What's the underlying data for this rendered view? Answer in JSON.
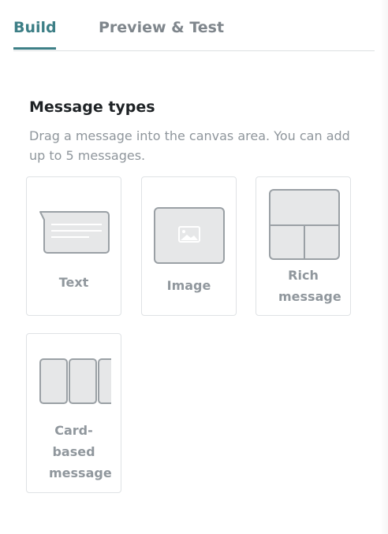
{
  "tabs": [
    {
      "label": "Build",
      "active": true
    },
    {
      "label": "Preview & Test",
      "active": false
    }
  ],
  "section": {
    "title": "Message types",
    "description": "Drag a message into the canvas area. You can add up to 5 messages."
  },
  "message_types": [
    {
      "label": "Text",
      "icon": "text-message-icon"
    },
    {
      "label": "Image",
      "icon": "image-message-icon"
    },
    {
      "label": "Rich message",
      "icon": "rich-message-icon"
    },
    {
      "label": "Card-based message",
      "icon": "card-based-message-icon"
    }
  ],
  "colors": {
    "accent": "#3d7f86",
    "icon_fill": "#e6e7e8",
    "icon_stroke": "#9aa0a5",
    "muted_text": "#90979d"
  }
}
